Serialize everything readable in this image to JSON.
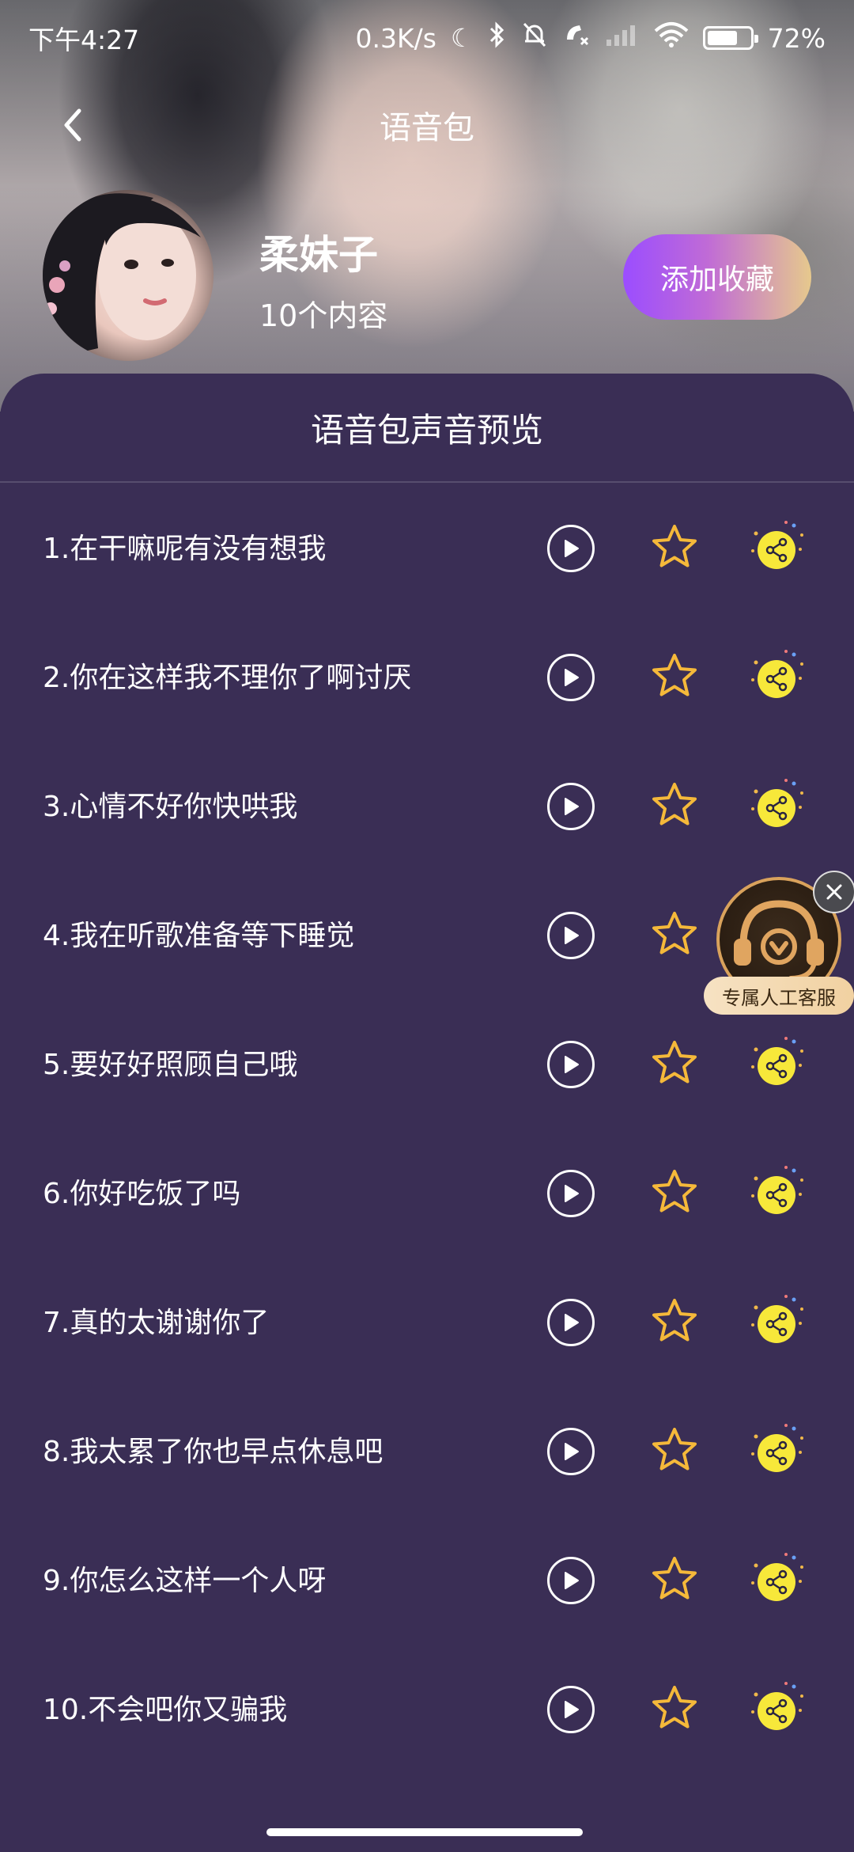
{
  "status_bar": {
    "time": "下午4:27",
    "network_speed": "0.3K/s",
    "battery_percent": 72,
    "battery_text": "72%"
  },
  "nav": {
    "title": "语音包"
  },
  "profile": {
    "name": "柔妹子",
    "content_count": "10个内容",
    "favorite_button": "添加收藏"
  },
  "panel": {
    "title": "语音包声音预览",
    "items": [
      {
        "label": "1.在干嘛呢有没有想我"
      },
      {
        "label": "2.你在这样我不理你了啊讨厌"
      },
      {
        "label": "3.心情不好你快哄我"
      },
      {
        "label": "4.我在听歌准备等下睡觉"
      },
      {
        "label": "5.要好好照顾自己哦"
      },
      {
        "label": "6.你好吃饭了吗"
      },
      {
        "label": "7.真的太谢谢你了"
      },
      {
        "label": "8.我太累了你也早点休息吧"
      },
      {
        "label": "9.你怎么这样一个人呀"
      },
      {
        "label": "10.不会吧你又骗我"
      }
    ]
  },
  "floating_service": {
    "label": "专属人工客服"
  },
  "icons": {
    "back": "chevron-left-icon",
    "play": "play-icon",
    "favorite": "star-icon",
    "share": "share-icon",
    "close": "close-icon",
    "headset": "headset-icon"
  },
  "colors": {
    "panel_background": "#3a2e55",
    "star": "#f5b93a",
    "share_badge": "#f7e83a",
    "favorite_button_start": "#9b4dff",
    "favorite_button_end": "#e6c98d"
  }
}
